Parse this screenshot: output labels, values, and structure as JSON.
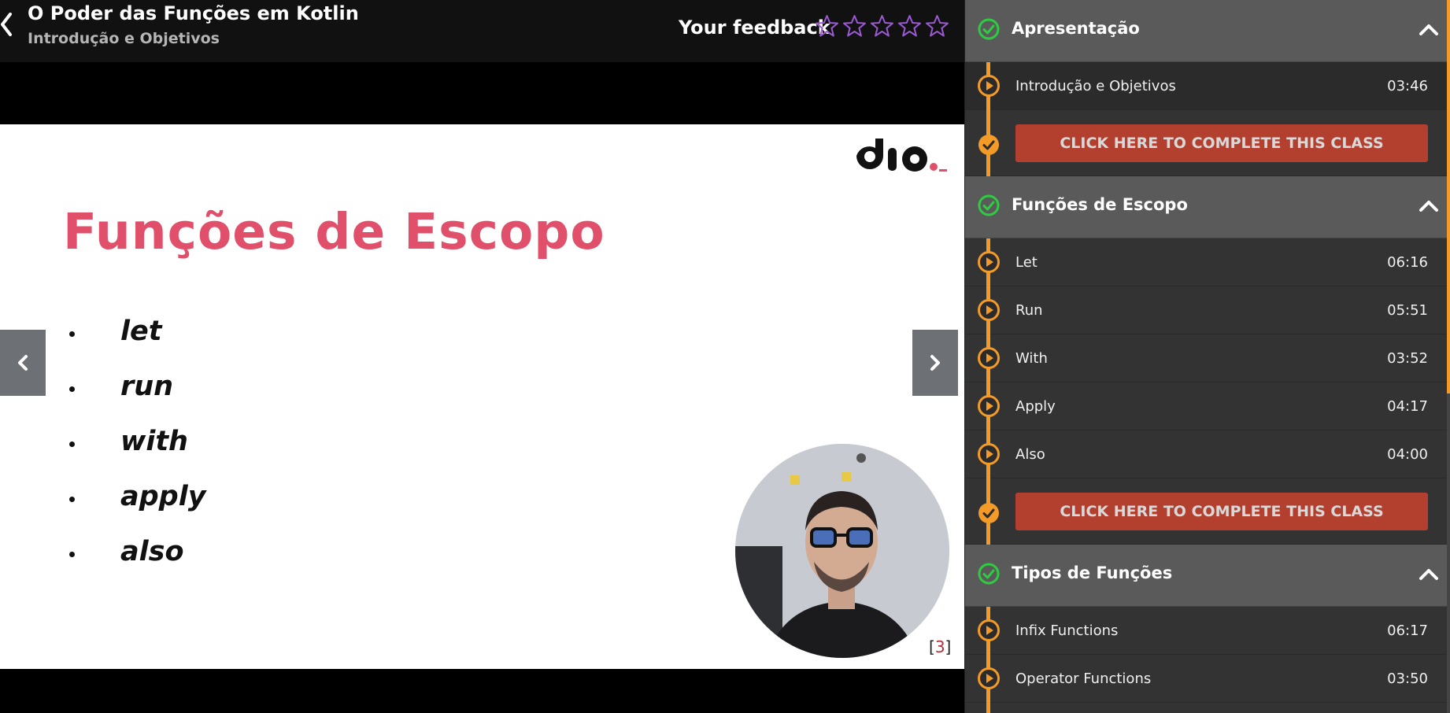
{
  "header": {
    "course_title": "O Poder das Funções em Kotlin",
    "lesson_subtitle": "Introdução e Objetivos",
    "feedback_label": "Your feedback",
    "rating": {
      "value": 0,
      "max": 5
    }
  },
  "slide": {
    "title": "Funções de Escopo",
    "bullets": [
      "let",
      "run",
      "with",
      "apply",
      "also"
    ],
    "page_open": "[",
    "page_number": "3",
    "page_close": "]",
    "logo_icon": "dio-logo"
  },
  "sidebar": {
    "complete_label": "CLICK HERE TO COMPLETE THIS CLASS",
    "sections": [
      {
        "title": "Apresentação",
        "lessons": [
          {
            "name": "Introdução e Objetivos",
            "duration": "03:46"
          }
        ]
      },
      {
        "title": "Funções de Escopo",
        "lessons": [
          {
            "name": "Let",
            "duration": "06:16"
          },
          {
            "name": "Run",
            "duration": "05:51"
          },
          {
            "name": "With",
            "duration": "03:52"
          },
          {
            "name": "Apply",
            "duration": "04:17"
          },
          {
            "name": "Also",
            "duration": "04:00"
          }
        ]
      },
      {
        "title": "Tipos de Funções",
        "lessons": [
          {
            "name": "Infix Functions",
            "duration": "06:17"
          },
          {
            "name": "Operator Functions",
            "duration": "03:50"
          }
        ]
      }
    ]
  },
  "colors": {
    "accent_orange": "#f39a27",
    "complete_red": "#b3402e",
    "slide_title_pink": "#e1506a",
    "check_green": "#2ecc40",
    "star_purple": "#9b59d6"
  },
  "icons": {
    "back": "chevron-left-icon",
    "star": "star-outline-icon",
    "prev": "chevron-left-icon",
    "next": "chevron-right-icon",
    "section_done": "check-circle-icon",
    "collapse": "chevron-up-icon",
    "lesson": "play-circle-icon",
    "complete": "check-circle-icon"
  }
}
